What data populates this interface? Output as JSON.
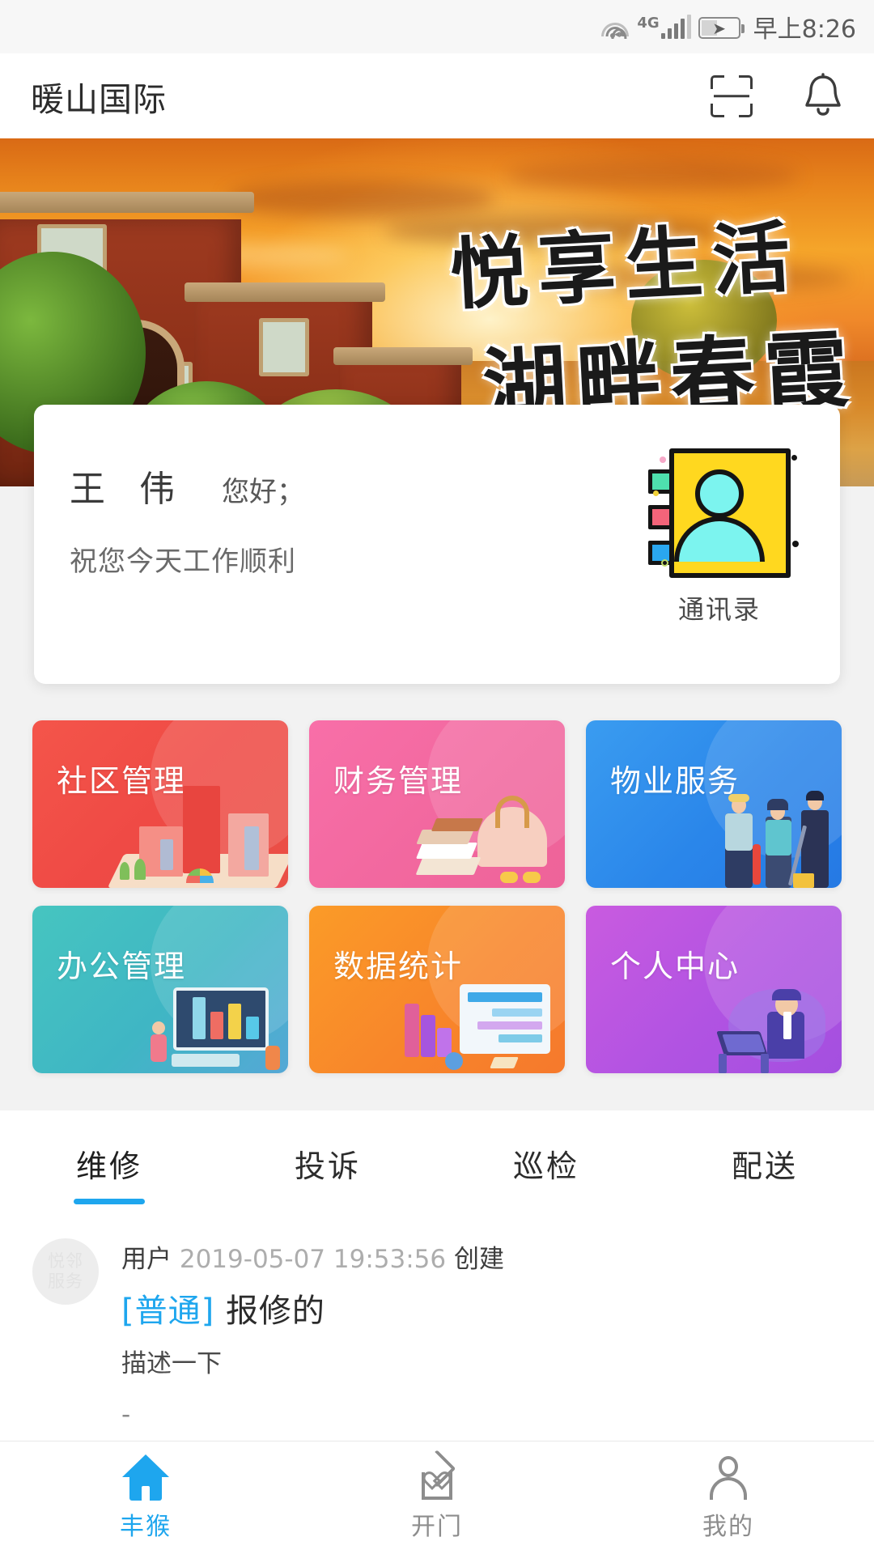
{
  "statusbar": {
    "time": "早上8:26",
    "network_label": "4G",
    "icons": [
      "wifi-icon",
      "signal-bars-icon",
      "battery-charging-icon"
    ]
  },
  "header": {
    "title": "暖山国际",
    "scan_icon": "scan-qr-icon",
    "bell_icon": "notification-bell-icon"
  },
  "banner": {
    "calligraphy_line1": "悦享生活",
    "calligraphy_line2": "湖畔春霞"
  },
  "greeting": {
    "name": "王 伟",
    "hello": "您好；",
    "wish": "祝您今天工作顺利",
    "contacts_label": "通讯录",
    "contacts_icon": "address-book-icon"
  },
  "grid": {
    "tiles": [
      {
        "label": "社区管理",
        "color": "#f0514a",
        "icon": "community-buildings-icon"
      },
      {
        "label": "财务管理",
        "color": "#f2689f",
        "icon": "finance-money-icon"
      },
      {
        "label": "物业服务",
        "color": "#2a86ea",
        "icon": "property-staff-icon"
      },
      {
        "label": "办公管理",
        "color": "#42bcc2",
        "icon": "office-desktop-icon"
      },
      {
        "label": "数据统计",
        "color": "#f8862a",
        "icon": "data-chart-icon"
      },
      {
        "label": "个人中心",
        "color": "#b153e2",
        "icon": "profile-person-icon"
      }
    ]
  },
  "tabs": {
    "active_index": 0,
    "accent_color": "#1ea6ee",
    "items": [
      {
        "label": "维修"
      },
      {
        "label": "投诉"
      },
      {
        "label": "巡检"
      },
      {
        "label": "配送"
      }
    ]
  },
  "list": {
    "items": [
      {
        "avatar_line1": "悦邻",
        "avatar_line2": "服务",
        "meta_user": "用户",
        "meta_time": "2019-05-07 19:53:56",
        "meta_action": "创建",
        "priority": "[普通]",
        "title": "报修的",
        "description": "描述一下",
        "extra": "-"
      }
    ]
  },
  "bottomnav": {
    "active_index": 0,
    "items": [
      {
        "label": "丰猴",
        "icon": "home-icon"
      },
      {
        "label": "开门",
        "icon": "door-house-heart-icon"
      },
      {
        "label": "我的",
        "icon": "profile-person-icon"
      }
    ]
  }
}
